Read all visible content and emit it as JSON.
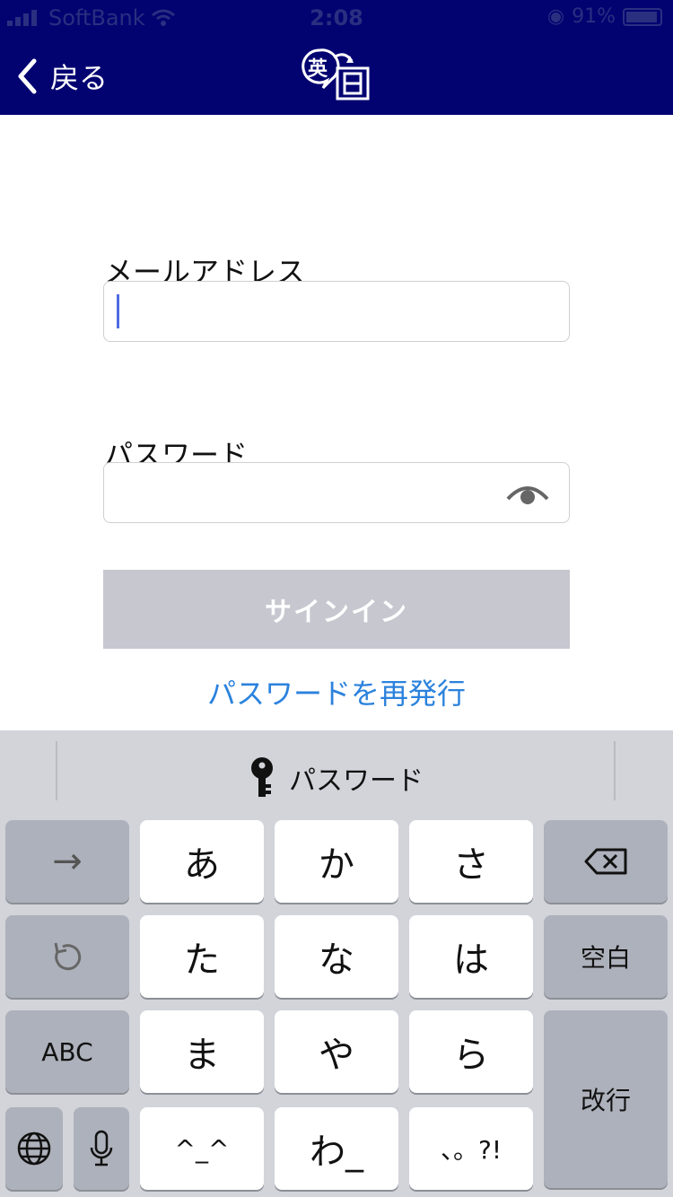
{
  "status_bar": {
    "carrier": "SoftBank",
    "time": "2:08",
    "battery": "91%"
  },
  "header": {
    "back_label": "戻る",
    "logo_text": "英日"
  },
  "form": {
    "email_label": "メールアドレス",
    "email_value": "",
    "password_label": "パスワード",
    "password_value": "",
    "signin_label": "サインイン",
    "reissue_label": "パスワードを再発行"
  },
  "keyboard": {
    "suggestion": "パスワード",
    "rows": [
      [
        "→",
        "あ",
        "か",
        "さ",
        "⌫"
      ],
      [
        "↺",
        "た",
        "な",
        "は",
        "空白"
      ],
      [
        "ABC",
        "ま",
        "や",
        "ら",
        "改行"
      ],
      [
        "🌐",
        "🎤",
        "^_^",
        "わ_",
        "、。?!"
      ]
    ],
    "keys": {
      "arrow": "→",
      "a": "あ",
      "ka": "か",
      "sa": "さ",
      "ta": "た",
      "na": "な",
      "ha": "は",
      "space": "空白",
      "abc": "ABC",
      "ma": "ま",
      "ya": "や",
      "ra": "ら",
      "return": "改行",
      "emoticon": "^_^",
      "wa": "わ_",
      "punct": "、。?!"
    }
  },
  "colors": {
    "header_bg": "#020371",
    "link": "#2b82dd",
    "button_disabled": "#c7c7d0",
    "caret": "#4d6be3"
  }
}
